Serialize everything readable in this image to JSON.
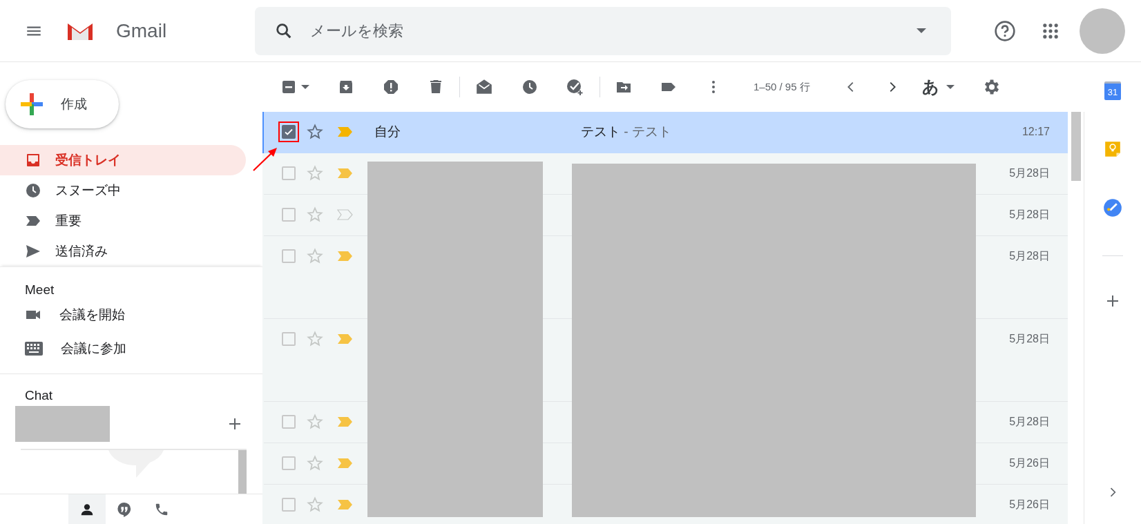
{
  "header": {
    "app_name": "Gmail",
    "search": {
      "placeholder": "メールを検索"
    }
  },
  "compose": {
    "label": "作成"
  },
  "nav": [
    {
      "label": "受信トレイ",
      "selected": true
    },
    {
      "label": "スヌーズ中",
      "selected": false
    },
    {
      "label": "重要",
      "selected": false
    },
    {
      "label": "送信済み",
      "selected": false
    }
  ],
  "meet": {
    "title": "Meet",
    "items": [
      "会議を開始",
      "会議に参加"
    ]
  },
  "chat": {
    "title": "Chat"
  },
  "hangouts_tabs": [
    {
      "selected": true
    },
    {
      "selected": false
    },
    {
      "selected": false
    }
  ],
  "toolbar": {
    "pagination": "1–50 / 95 行",
    "input_tool": "あ"
  },
  "emails": [
    {
      "kind": "standard",
      "selected": true,
      "checked": true,
      "highlighted": true,
      "starred": false,
      "important": true,
      "redacted": false,
      "sender": "自分",
      "subject": "テスト",
      "snippet": "- テスト",
      "date": "12:17"
    },
    {
      "kind": "standard",
      "selected": false,
      "checked": false,
      "highlighted": false,
      "starred": false,
      "important": true,
      "redacted": true,
      "date": "5月28日"
    },
    {
      "kind": "standard",
      "selected": false,
      "checked": false,
      "highlighted": false,
      "starred": false,
      "important": false,
      "redacted": true,
      "date": "5月28日"
    },
    {
      "kind": "with_attachments",
      "selected": false,
      "checked": false,
      "highlighted": false,
      "starred": false,
      "important": true,
      "redacted": true,
      "date": "5月28日"
    },
    {
      "kind": "with_attachments",
      "selected": false,
      "checked": false,
      "highlighted": false,
      "starred": false,
      "important": true,
      "redacted": true,
      "date": "5月28日"
    },
    {
      "kind": "standard",
      "selected": false,
      "checked": false,
      "highlighted": false,
      "starred": false,
      "important": true,
      "redacted": true,
      "date": "5月28日"
    },
    {
      "kind": "standard",
      "selected": false,
      "checked": false,
      "highlighted": false,
      "starred": false,
      "important": true,
      "redacted": true,
      "date": "5月26日"
    },
    {
      "kind": "standard",
      "selected": false,
      "checked": false,
      "highlighted": false,
      "starred": false,
      "important": true,
      "redacted": true,
      "date": "5月26日"
    }
  ],
  "rail": {
    "calendar_day": "31"
  }
}
